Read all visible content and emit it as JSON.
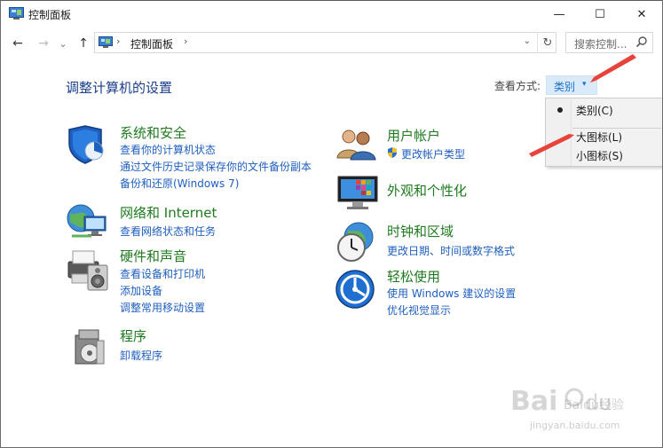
{
  "window": {
    "title": "控制面板",
    "minimize_glyph": "—",
    "maximize_glyph": "☐",
    "close_glyph": "✕"
  },
  "navigation": {
    "back_glyph": "←",
    "forward_glyph": "→",
    "recent_glyph": "⌄",
    "up_glyph": "↑",
    "address_path": "控制面板",
    "address_sep": "›",
    "dropdown_glyph": "⌄",
    "refresh_glyph": "↻",
    "search_placeholder": "搜索控制..."
  },
  "main": {
    "page_title": "调整计算机的设置",
    "view_label": "查看方式:",
    "view_value": "类别",
    "view_arrow": "▾"
  },
  "view_menu": {
    "items": [
      {
        "label": "类别(C)",
        "selected": true
      },
      {
        "label": "大图标(L)",
        "selected": false
      },
      {
        "label": "小图标(S)",
        "selected": false
      }
    ]
  },
  "categories": {
    "system": {
      "title": "系统和安全",
      "links": [
        "查看你的计算机状态",
        "通过文件历史记录保存你的文件备份副本",
        "备份和还原(Windows 7)"
      ]
    },
    "network": {
      "title": "网络和 Internet",
      "links": [
        "查看网络状态和任务"
      ]
    },
    "hardware": {
      "title": "硬件和声音",
      "links": [
        "查看设备和打印机",
        "添加设备",
        "调整常用移动设置"
      ]
    },
    "programs": {
      "title": "程序",
      "links": [
        "卸载程序"
      ]
    },
    "users": {
      "title": "用户帐户",
      "links": [
        "更改帐户类型"
      ]
    },
    "appearance": {
      "title": "外观和个性化",
      "links": []
    },
    "clock": {
      "title": "时钟和区域",
      "links": [
        "更改日期、时间或数字格式"
      ]
    },
    "ease": {
      "title": "轻松使用",
      "links": [
        "使用 Windows 建议的设置",
        "优化视觉显示"
      ]
    }
  },
  "colors": {
    "link": "#1f5fbf",
    "category_title": "#1f7a1f",
    "page_title": "#1b3f8b",
    "annotation_arrow": "#e8433b"
  },
  "watermark": {
    "brand": "Baidu经验",
    "url": "jingyan.baidu.com"
  }
}
